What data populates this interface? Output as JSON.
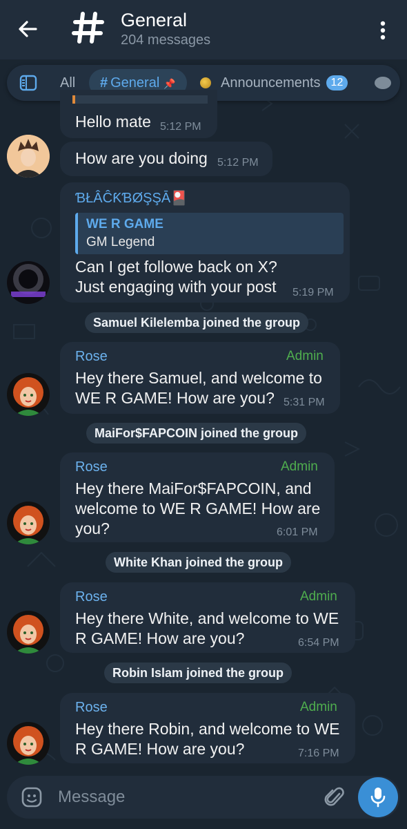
{
  "header": {
    "title": "General",
    "subtitle": "204 messages"
  },
  "topics": {
    "tabs": [
      {
        "label": "All"
      },
      {
        "label": "General"
      },
      {
        "label": "Announcements",
        "badge": "12"
      }
    ]
  },
  "messages": {
    "partial_reply_text": "Hello mate",
    "partial_reply_time": "5:12 PM",
    "m1": {
      "text": "How are you doing",
      "time": "5:12 PM"
    },
    "m2": {
      "sender": "ƁŁÂĈƘƁØŞŞĀ🎴",
      "quote_title": "WE R GAME",
      "quote_text": "GM Legend",
      "line1": "Can I get followe back on X?",
      "line2": "Just engaging with your post",
      "time": "5:19 PM"
    },
    "s1": "Samuel Kilelemba joined the group",
    "m3": {
      "sender": "Rose",
      "role": "Admin",
      "line1": "Hey there Samuel, and welcome to",
      "line2": "WE R GAME! How are you?",
      "time": "5:31 PM"
    },
    "s2": "MaiFor$FAPCOIN joined the group",
    "m4": {
      "sender": "Rose",
      "role": "Admin",
      "line1": "Hey there MaiFor$FAPCOIN, and",
      "line2": "welcome to WE R GAME! How are",
      "line3": "you?",
      "time": "6:01 PM"
    },
    "s3": "White Khan joined the group",
    "m5": {
      "sender": "Rose",
      "role": "Admin",
      "line1": "Hey there White, and welcome to WE",
      "line2": "R GAME! How are you?",
      "time": "6:54 PM"
    },
    "s4": "Robin Islam joined the group",
    "m6": {
      "sender": "Rose",
      "role": "Admin",
      "line1": "Hey there Robin, and welcome to WE",
      "line2": "R GAME! How are you?",
      "time": "7:16 PM"
    }
  },
  "composer": {
    "placeholder": "Message"
  },
  "colors": {
    "accent": "#5eaaec",
    "admin": "#4fae4e",
    "sender_blackbossa": "#5eaaec",
    "sender_rose": "#6cb2ee"
  },
  "icons": [
    "back-arrow-icon",
    "hash-icon",
    "more-vertical-icon",
    "topics-sidebar-icon",
    "pin-icon",
    "emoji-icon",
    "attach-icon",
    "mic-icon"
  ]
}
